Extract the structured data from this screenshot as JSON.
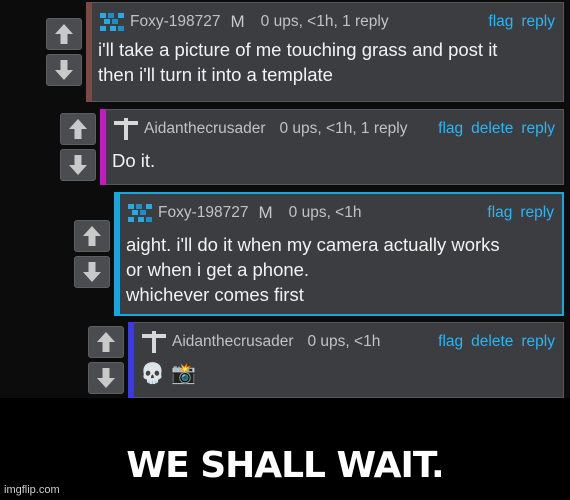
{
  "colors": {
    "link": "#29b6f6",
    "stripe_reply1": "#7b4a45",
    "stripe_reply2": "#c21bc2",
    "stripe_reply3": "#14a8e0",
    "stripe_reply4": "#3a3ae8"
  },
  "comments": [
    {
      "username": "Foxy-198727",
      "avatar": "pixel-avatar-icon",
      "mod_badge": "M",
      "meta": "0 ups, <1h, 1 reply",
      "actions": [
        "flag",
        "reply"
      ],
      "lines": [
        "i'll take a picture of me touching grass and post it",
        "then i'll turn it into a template"
      ]
    },
    {
      "username": "Aidanthecrusader",
      "avatar": "cross-avatar-icon",
      "meta": "0 ups, <1h, 1 reply",
      "actions": [
        "flag",
        "delete",
        "reply"
      ],
      "lines": [
        "Do it."
      ]
    },
    {
      "username": "Foxy-198727",
      "avatar": "pixel-avatar-icon",
      "mod_badge": "M",
      "meta": "0 ups, <1h",
      "actions": [
        "flag",
        "reply"
      ],
      "lines": [
        "aight. i'll do it when my camera actually works",
        "or when i get a phone.",
        "whichever comes first"
      ]
    },
    {
      "username": "Aidanthecrusader",
      "avatar": "cross-avatar-icon",
      "meta": "0 ups, <1h",
      "actions": [
        "flag",
        "delete",
        "reply"
      ],
      "lines": [
        "💀 📸"
      ]
    }
  ],
  "caption": "WE SHALL WAIT.",
  "watermark": "imgflip.com"
}
